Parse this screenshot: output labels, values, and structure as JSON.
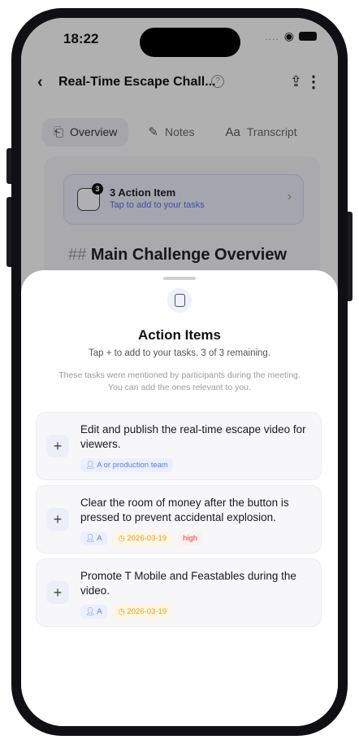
{
  "status_bar": {
    "time": "18:22",
    "signal": "....",
    "wifi": "▾"
  },
  "nav": {
    "back_icon": "‹",
    "title": "Real-Time Escape Chall...",
    "help_icon": "?",
    "share_icon": "⇪",
    "more_icon": "⋮"
  },
  "tabs": [
    {
      "label": "Overview",
      "icon": "⎗"
    },
    {
      "label": "Notes",
      "icon": "✎"
    },
    {
      "label": "Transcript",
      "icon": "Aa"
    }
  ],
  "banner": {
    "badge": "3",
    "title": "3 Action Item",
    "subtitle": "Tap to add to your tasks",
    "chevron": "›"
  },
  "content": {
    "hash": "##",
    "heading": "Main Challenge Overview"
  },
  "sheet": {
    "title": "Action Items",
    "subtitle": "Tap + to add to your tasks. 3 of 3 remaining.",
    "note": "These tasks were mentioned by participants during the meeting. You can add the ones relevant to you.",
    "plus_label": "+",
    "items": [
      {
        "text": "Edit and publish the real-time escape video for viewers.",
        "assignee": "A or production team",
        "date": "",
        "priority": ""
      },
      {
        "text": "Clear the room of money after the button is pressed to prevent accidental explosion.",
        "assignee": "A",
        "date": "2026-03-19",
        "priority": "high"
      },
      {
        "text": "Promote T Mobile and Feastables during the video.",
        "assignee": "A",
        "date": "2026-03-19",
        "priority": ""
      }
    ]
  },
  "colors": {
    "accent": "#5a6ee0",
    "date": "#e0a020",
    "priority_high": "#e04848"
  }
}
